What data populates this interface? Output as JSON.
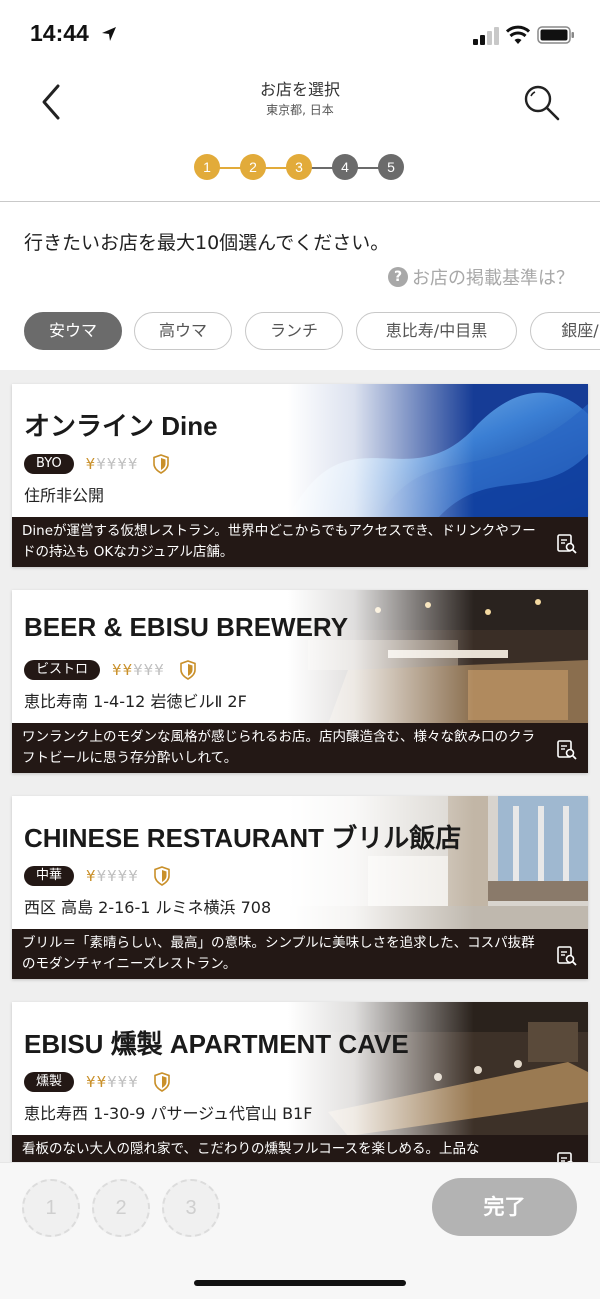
{
  "status_bar": {
    "time": "14:44",
    "icons": [
      "location-arrow-icon",
      "signal-icon",
      "wifi-icon",
      "battery-icon"
    ]
  },
  "nav": {
    "title": "お店を選択",
    "subtitle": "東京都, 日本",
    "back_icon": "chevron-left-icon",
    "search_icon": "search-icon"
  },
  "steps": {
    "items": [
      "1",
      "2",
      "3",
      "4",
      "5"
    ],
    "completed": 3,
    "active_color": "#e2ab3a",
    "inactive_color": "#6b6b6b"
  },
  "instruction": "行きたいお店を最大10個選んでください。",
  "criteria_link": "お店の掲載基準は？",
  "criteria_icon": "?",
  "filters": [
    "安ウマ",
    "高ウマ",
    "ランチ",
    "恵比寿/中目黒",
    "銀座/"
  ],
  "active_filter": "安ウマ",
  "restaurants": [
    {
      "name": "オンライン Dine",
      "category": "BYO",
      "price_level": 1,
      "price_max": 5,
      "address": "住所非公開",
      "description": "Dineが運営する仮想レストラン。世界中どこからでもアクセスでき、ドリンクやフードの持込も OKなカジュアル店舗。"
    },
    {
      "name": "BEER & EBISU BREWERY",
      "category": "ビストロ",
      "price_level": 2,
      "price_max": 5,
      "address": "恵比寿南 1-4-12 岩徳ビルⅡ 2F",
      "description": "ワンランク上のモダンな風格が感じられるお店。店内醸造含む、様々な飲み口のクラフトビールに思う存分酔いしれて。"
    },
    {
      "name": "CHINESE RESTAURANT ブリル飯店",
      "category": "中華",
      "price_level": 1,
      "price_max": 5,
      "address": "西区 高島 2-16-1 ルミネ横浜 708",
      "description": "ブリル＝「素晴らしい、最高」の意味。シンプルに美味しさを追求した、コスパ抜群のモダンチャイニーズレストラン。"
    },
    {
      "name": "EBISU 燻製 APARTMENT CAVE",
      "category": "燻製",
      "price_level": 2,
      "price_max": 5,
      "address": "恵比寿西 1-30-9 パサージュ代官山 B1F",
      "description": "看板のない大人の隠れ家で、こだわりの燻製フルコースを楽しめる。上品な"
    }
  ],
  "yen_symbol": "¥",
  "selection_slots": [
    "1",
    "2",
    "3"
  ],
  "done_button": "完了",
  "colors": {
    "accent_gold": "#e2ab3a",
    "dark_panel": "#231815",
    "chip_active": "#6b6b6b",
    "done_disabled": "#b3b3b3"
  }
}
